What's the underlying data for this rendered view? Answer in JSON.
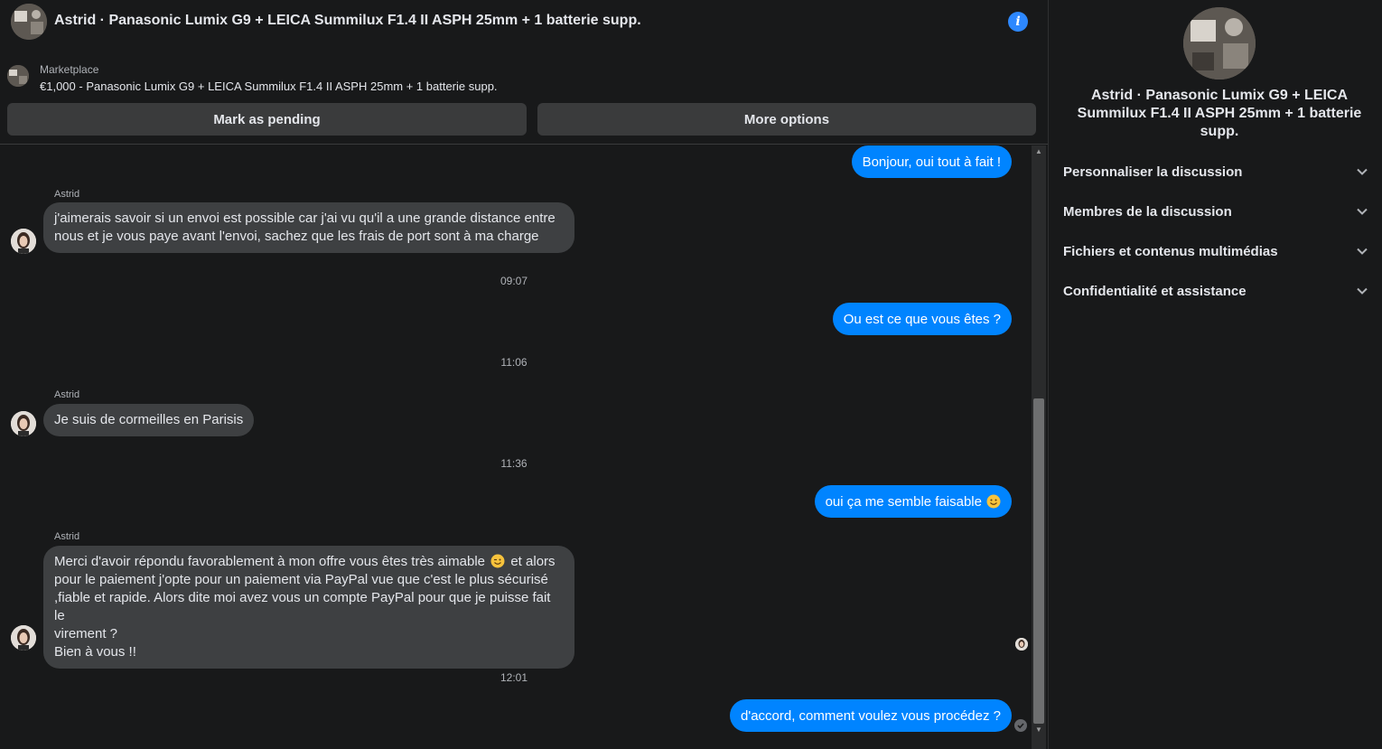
{
  "header": {
    "title": "Astrid · Panasonic Lumix G9 + LEICA Summilux F1.4 II ASPH 25mm + 1 batterie supp.",
    "info_icon": "info-icon"
  },
  "marketplace": {
    "label": "Marketplace",
    "listing": "€1,000 - Panasonic Lumix G9 + LEICA Summilux F1.4 II ASPH 25mm + 1 batterie supp."
  },
  "actions": {
    "pending_label": "Mark as pending",
    "more_label": "More options"
  },
  "thread": {
    "sender_name": "Astrid",
    "messages": [
      {
        "text": "Bonjour, oui tout à fait !"
      },
      {
        "line1": "j'aimerais savoir si un envoi est possible car j'ai vu qu'il a une grande distance entre",
        "line2": "nous et je vous paye avant l'envoi, sachez que les frais de port sont à ma charge"
      },
      {
        "stamp": "09:07"
      },
      {
        "text": "Ou est ce que vous êtes ?"
      },
      {
        "stamp": "11:06"
      },
      {
        "text": "Je suis de cormeilles en Parisis"
      },
      {
        "stamp": "11:36"
      },
      {
        "text": "oui ça me semble faisable"
      },
      {
        "line1a": "Merci d'avoir répondu favorablement à mon offre vous êtes très aimable",
        "line1b": "et alors",
        "line2": "pour le paiement j'opte pour un paiement via PayPal vue que c'est le plus sécurisé",
        "line3": ",fiable et rapide. Alors dite moi avez vous un compte PayPal pour que je puisse fait le",
        "line4": "virement ?",
        "line5": "Bien à vous !!"
      },
      {
        "stamp": "12:01"
      },
      {
        "text": "d'accord, comment voulez vous procédez ?"
      }
    ]
  },
  "side": {
    "title": "Astrid · Panasonic Lumix G9 + LEICA Summilux F1.4 II ASPH 25mm + 1 batterie supp.",
    "items": [
      {
        "label": "Personnaliser la discussion"
      },
      {
        "label": "Membres de la discussion"
      },
      {
        "label": "Fichiers et contenus multimédias"
      },
      {
        "label": "Confidentialité et assistance"
      }
    ]
  },
  "colors": {
    "background": "#18191a",
    "outgoing_bubble": "#0084ff",
    "incoming_bubble": "#3e4042",
    "button": "#3a3b3c",
    "accent": "#2d88ff"
  }
}
